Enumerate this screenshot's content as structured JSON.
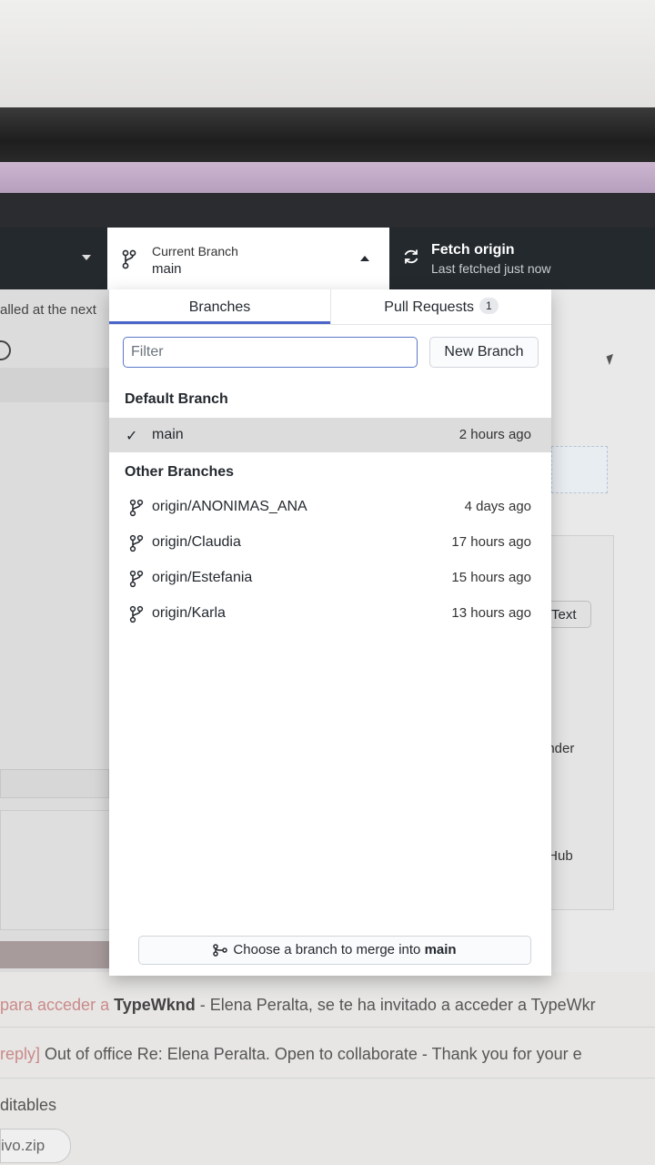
{
  "toolbar": {
    "current_branch_label": "Current Branch",
    "current_branch_value": "main",
    "fetch_title": "Fetch origin",
    "fetch_subtitle": "Last fetched just now"
  },
  "background": {
    "left_text": "alled at the next",
    "right_button": "Text",
    "right_text_1": "inder",
    "right_text_2": "tHub"
  },
  "dropdown": {
    "tabs": {
      "branches": "Branches",
      "pull_requests": "Pull Requests",
      "pr_count": "1"
    },
    "filter_placeholder": "Filter",
    "new_branch_label": "New Branch",
    "default_section": "Default Branch",
    "default_branch": {
      "name": "main",
      "time": "2 hours ago"
    },
    "other_section": "Other Branches",
    "other_branches": [
      {
        "name": "origin/ANONIMAS_ANA",
        "time": "4 days ago"
      },
      {
        "name": "origin/Claudia",
        "time": "17 hours ago"
      },
      {
        "name": "origin/Estefania",
        "time": "15 hours ago"
      },
      {
        "name": "origin/Karla",
        "time": "13 hours ago"
      }
    ],
    "merge_prefix": "Choose a branch to merge into",
    "merge_target": "main"
  },
  "mail": {
    "line1_prefix": "para acceder a",
    "line1_bold": "TypeWknd",
    "line1_rest": " - Elena Peralta, se te ha invitado a acceder a TypeWkr",
    "line2_prefix": "reply]",
    "line2_rest": " Out of office Re: Elena Peralta. Open to collaborate - Thank you for your e",
    "line3": "ditables",
    "line4": "ivo.zip"
  },
  "colors": {
    "toolbar_bg": "#24292e",
    "accent_blue": "#4a64c8",
    "selected_row": "#dcdcdc"
  }
}
